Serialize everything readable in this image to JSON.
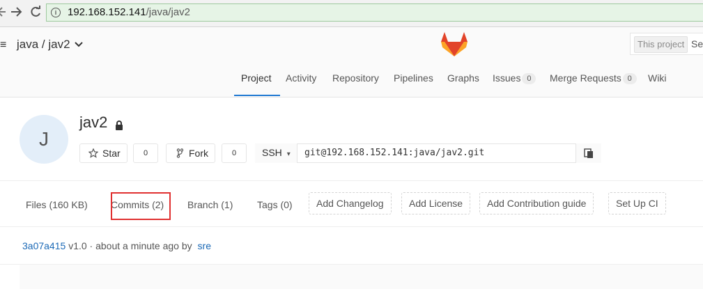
{
  "browser": {
    "back_icon": "back-arrow-icon",
    "forward_label": "→",
    "reload_label": "C",
    "url_host": "192.168.152.141",
    "url_path": "/java/jav2",
    "info_label": "i"
  },
  "header": {
    "menu_label": "≡",
    "project_path": "java / jav2",
    "path_caret": "⌄",
    "logo_icon": "gitlab-tanuki-icon",
    "search_scope": "This project",
    "search_placeholder": "Sea"
  },
  "nav": {
    "tabs": [
      {
        "label": "Project",
        "active": true
      },
      {
        "label": "Activity"
      },
      {
        "label": "Repository"
      },
      {
        "label": "Pipelines"
      },
      {
        "label": "Graphs"
      },
      {
        "label": "Issues",
        "badge": "0"
      },
      {
        "label": "Merge Requests",
        "badge": "0"
      },
      {
        "label": "Wiki"
      }
    ]
  },
  "project": {
    "avatar_letter": "J",
    "name": "jav2",
    "star_label": "Star",
    "star_count": "0",
    "fork_label": "Fork",
    "fork_count": "0",
    "clone_protocol": "SSH",
    "clone_caret": "▾",
    "clone_url": "git@192.168.152.141:java/jav2.git"
  },
  "stats": {
    "files": "Files (160 KB)",
    "commits": "Commits (2)",
    "branch": "Branch (1)",
    "tags": "Tags (0)",
    "add_changelog": "Add Changelog",
    "add_license": "Add License",
    "add_contribution": "Add Contribution guide",
    "setup_ci": "Set Up CI"
  },
  "last_commit": {
    "sha": "3a07a415",
    "message": "v1.0 · about a minute ago by",
    "author": "sre"
  },
  "colors": {
    "accent": "#1f78d1",
    "link": "#1b69b6",
    "highlight": "#e03030",
    "address_bg": "#e6f4e6"
  }
}
